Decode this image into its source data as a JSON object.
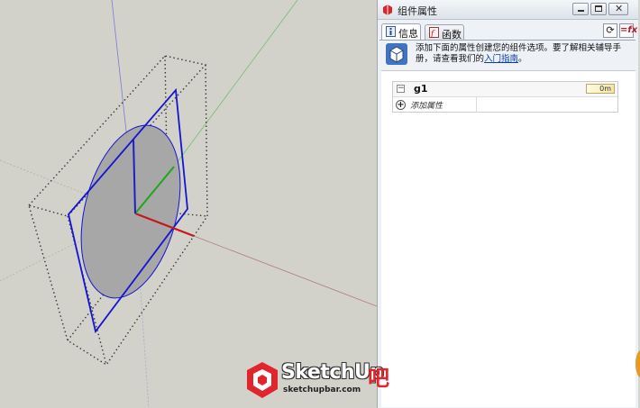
{
  "window": {
    "title": "组件属性",
    "minimize_glyph": "—",
    "maximize_glyph": "□",
    "close_glyph": "✕"
  },
  "tabs": [
    {
      "label": "信息",
      "active": true,
      "icon": "info-icon"
    },
    {
      "label": "函数",
      "active": false,
      "icon": "function-icon"
    }
  ],
  "toolbar": {
    "refresh_glyph": "⟳",
    "fx_glyph": "=fx"
  },
  "info": {
    "text": "添加下面的属性创建您的组件选项。要了解相关辅导手册，请查看我们的",
    "link": "入门指南",
    "tail": "。"
  },
  "attributes": {
    "component_name": "g1",
    "component_value": "0m",
    "toggle_glyph": "−",
    "add_glyph": "+",
    "add_label": "添加属性"
  },
  "watermark": {
    "brand": "SketchUp",
    "suffix": "吧",
    "url": "sketchupbar.com"
  },
  "colors": {
    "viewport_bg": "#d2d2cb",
    "axis_red": "#c8161d",
    "axis_green": "#1aa81a",
    "axis_blue": "#1e1ec8",
    "selection_blue": "#1414d2",
    "disc_fill": "#a7a7a7"
  }
}
